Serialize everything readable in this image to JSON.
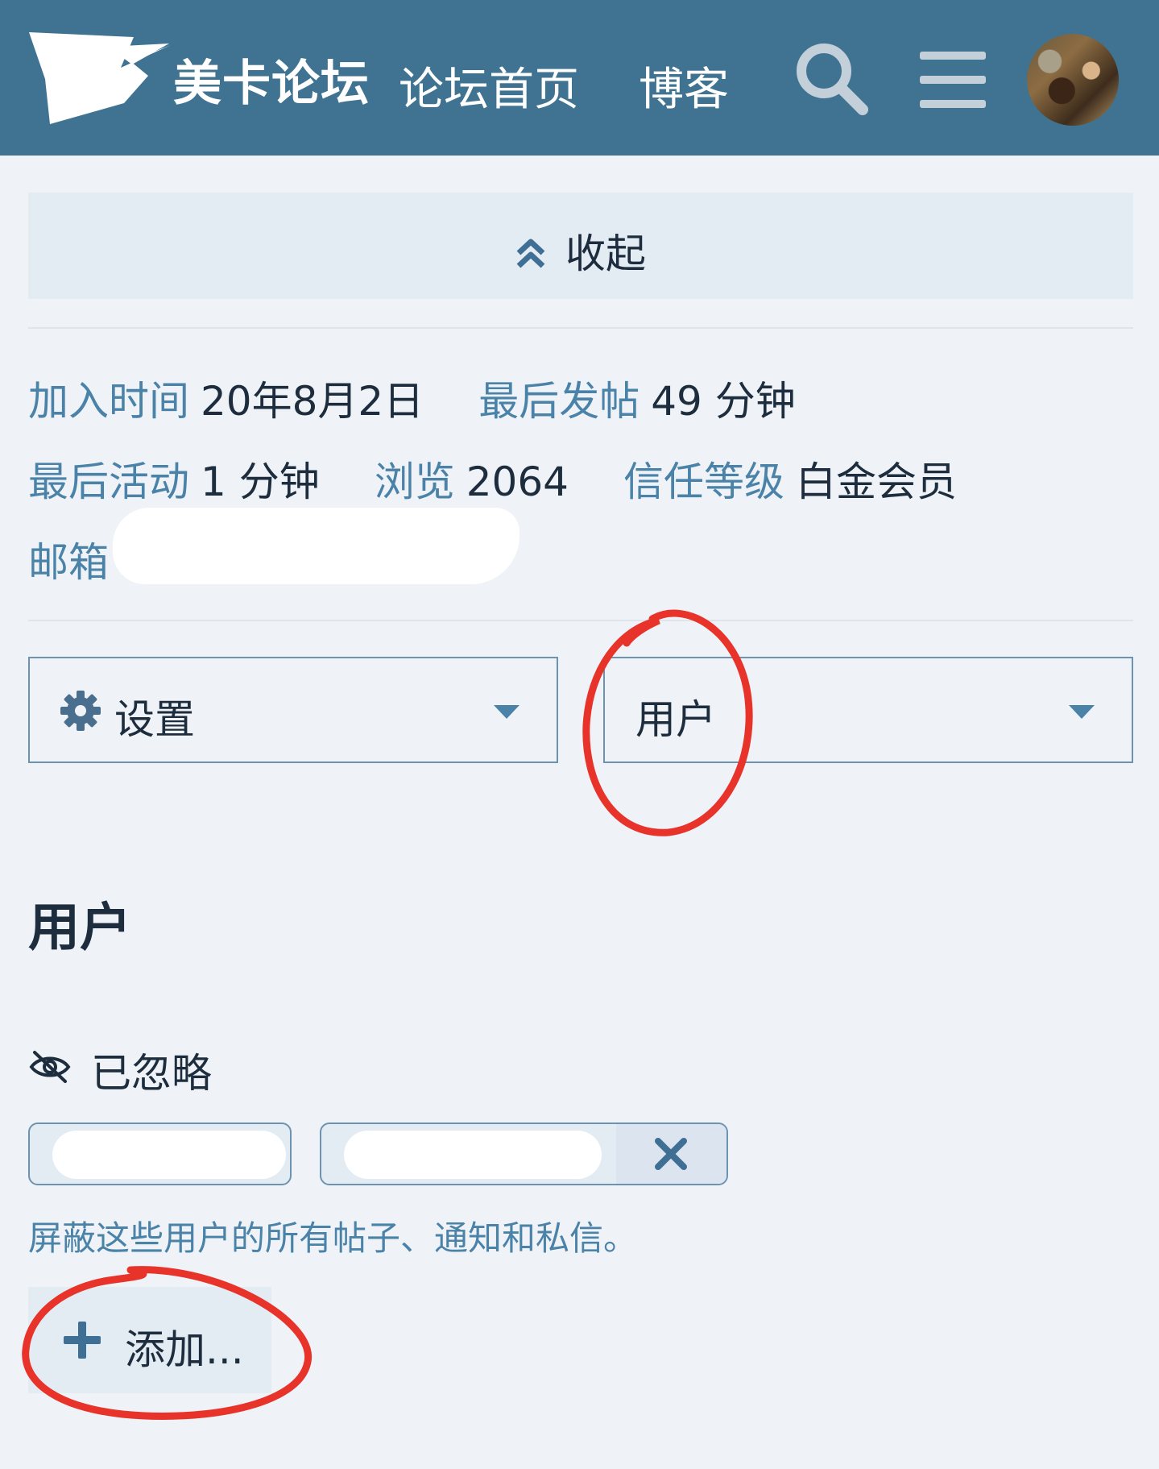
{
  "header": {
    "site_name": "美卡论坛",
    "nav": {
      "home": "论坛首页",
      "blog": "博客"
    },
    "icons": {
      "logo": "card-logo-icon",
      "search": "search-icon",
      "menu": "hamburger-menu-icon"
    },
    "background": "#3f7391"
  },
  "collapse": {
    "label": "收起",
    "icon": "double-chevron-up-icon"
  },
  "profile_stats": {
    "joined_label": "加入时间",
    "joined_value": "20年8月2日",
    "last_post_label": "最后发帖",
    "last_post_value": "49 分钟",
    "last_active_label": "最后活动",
    "last_active_value": "1 分钟",
    "views_label": "浏览",
    "views_value": "2064",
    "trust_label": "信任等级",
    "trust_value": "白金会员",
    "email_label": "邮箱"
  },
  "selects": {
    "settings": {
      "label": "设置",
      "icon": "gear-icon"
    },
    "category": {
      "label": "用户"
    }
  },
  "section": {
    "title": "用户"
  },
  "ignored": {
    "label": "已忽略",
    "icon": "eye-slash-icon",
    "hint": "屏蔽这些用户的所有帖子、通知和私信。",
    "add_label": "添加..."
  },
  "colors": {
    "label_blue": "#4a82a8",
    "text_dark": "#1d2d3d",
    "annotation_red": "#e8332a"
  }
}
